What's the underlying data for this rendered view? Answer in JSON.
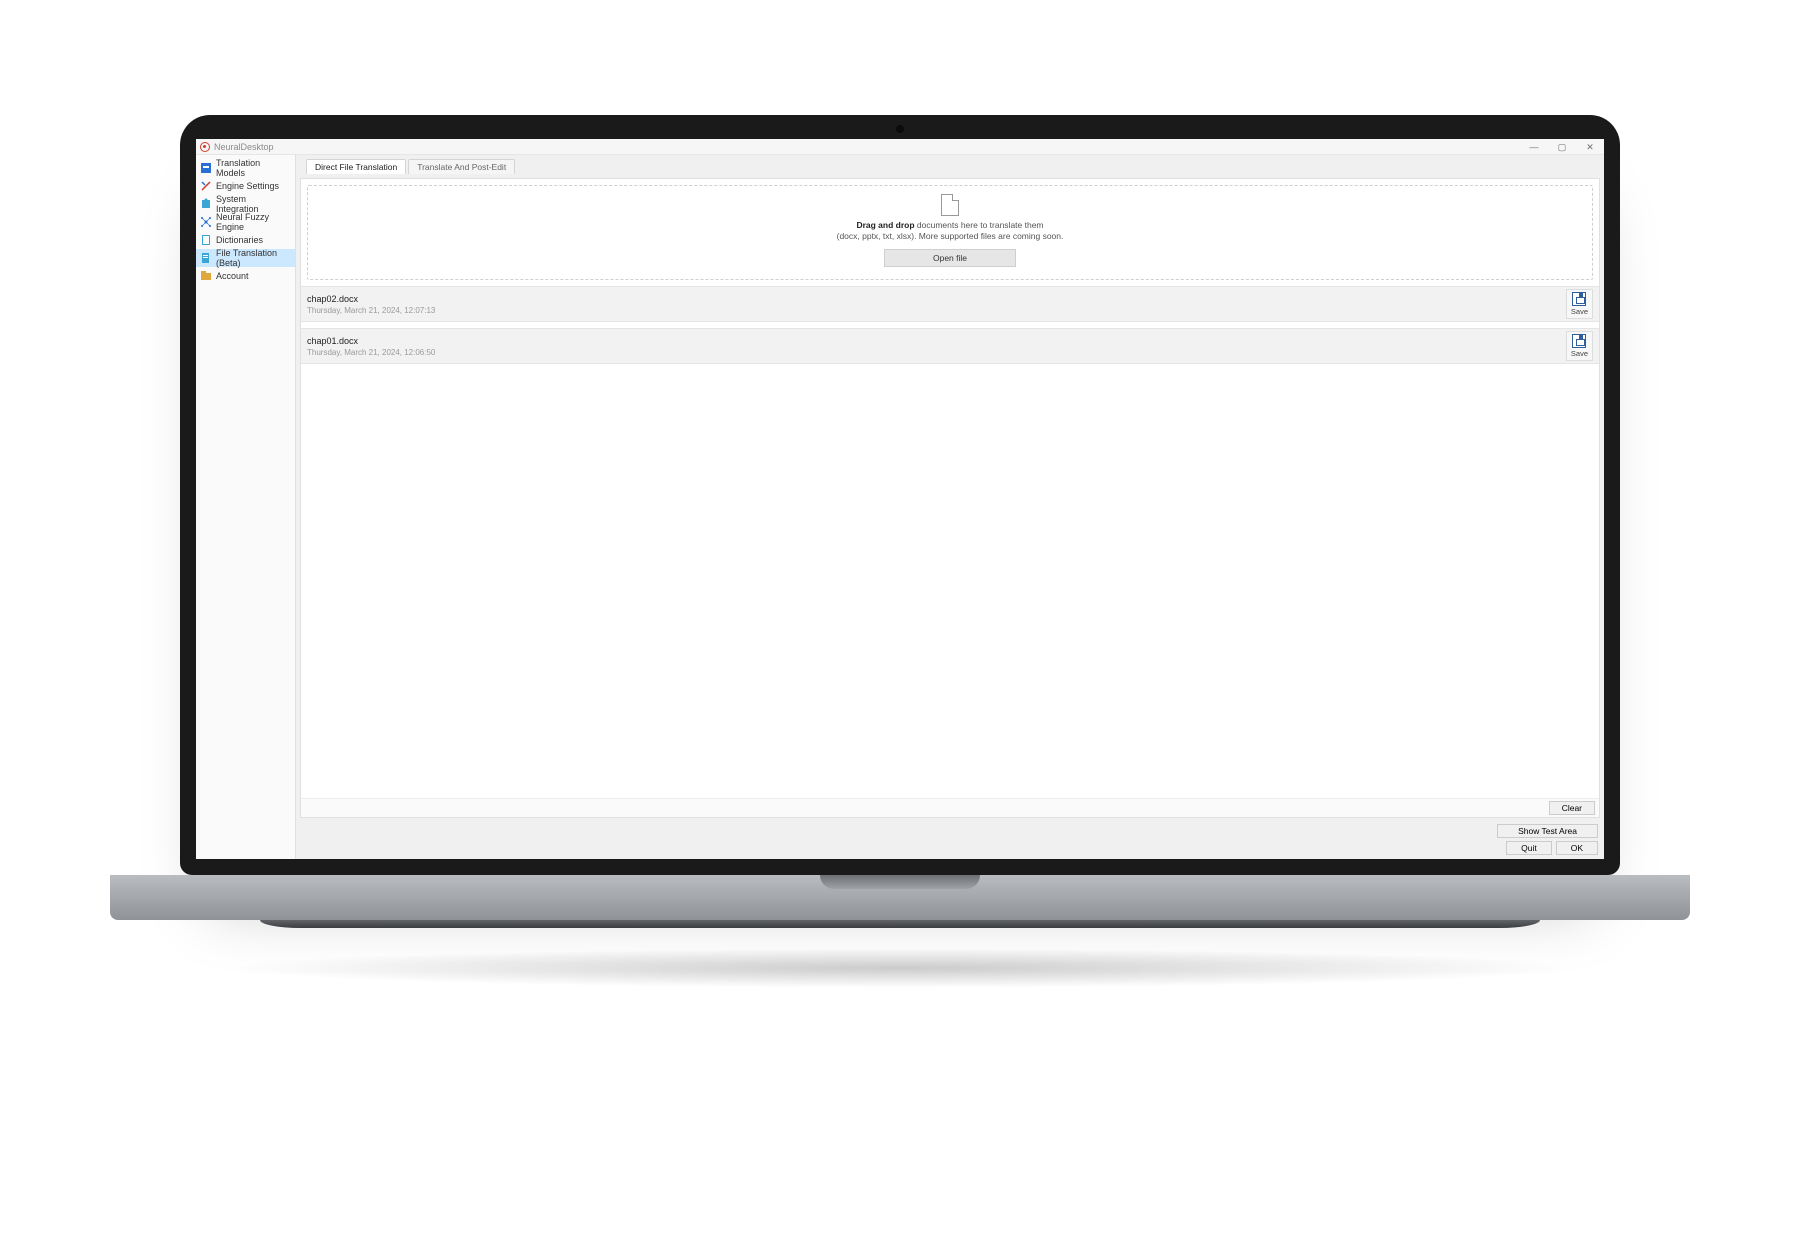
{
  "window": {
    "title": "NeuralDesktop",
    "controls": {
      "min": "—",
      "max": "▢",
      "close": "✕"
    }
  },
  "sidebar": {
    "items": [
      {
        "label": "Translation Models",
        "icon": "models-icon"
      },
      {
        "label": "Engine Settings",
        "icon": "tools-icon"
      },
      {
        "label": "System Integration",
        "icon": "puzzle-icon"
      },
      {
        "label": "Neural Fuzzy Engine",
        "icon": "neural-icon"
      },
      {
        "label": "Dictionaries",
        "icon": "book-icon"
      },
      {
        "label": "File Translation (Beta)",
        "icon": "file-icon"
      },
      {
        "label": "Account",
        "icon": "account-icon"
      }
    ],
    "active_index": 5
  },
  "tabs": {
    "items": [
      "Direct File Translation",
      "Translate And Post-Edit"
    ],
    "active_index": 0
  },
  "dropzone": {
    "bold_prefix": "Drag and drop",
    "line1_suffix": " documents here to translate them",
    "line2": "(docx, pptx, txt, xlsx). More supported files are coming soon.",
    "open_button": "Open file"
  },
  "files": [
    {
      "name": "chap02.docx",
      "date": "Thursday, March 21, 2024, 12:07:13",
      "action": "Save"
    },
    {
      "name": "chap01.docx",
      "date": "Thursday, March 21, 2024, 12:06:50",
      "action": "Save"
    }
  ],
  "panel_footer": {
    "clear": "Clear"
  },
  "bottom": {
    "show_test": "Show Test Area",
    "quit": "Quit",
    "ok": "OK"
  }
}
